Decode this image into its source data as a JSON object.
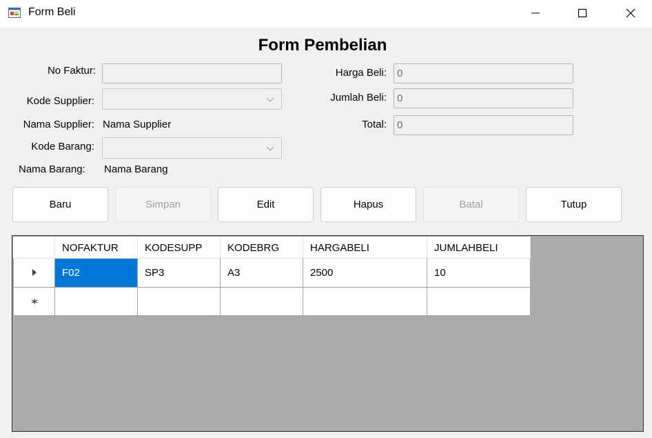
{
  "window": {
    "title": "Form Beli",
    "icon": "app-form-icon",
    "controls": [
      "minimize-icon",
      "maximize-icon",
      "close-icon"
    ]
  },
  "form": {
    "heading": "Form Pembelian",
    "left": {
      "no_faktur_label": "No Faktur:",
      "no_faktur_value": "",
      "kode_supplier_label": "Kode Supplier:",
      "kode_supplier_value": "",
      "nama_supplier_label": "Nama Supplier:",
      "nama_supplier_value": "Nama Supplier",
      "kode_barang_label": "Kode Barang:",
      "kode_barang_value": "",
      "nama_barang_label": "Nama Barang:",
      "nama_barang_value": "Nama Barang"
    },
    "right": {
      "harga_beli_label": "Harga Beli:",
      "harga_beli_value": "0",
      "jumlah_beli_label": "Jumlah Beli:",
      "jumlah_beli_value": "0",
      "total_label": "Total:",
      "total_value": "0"
    }
  },
  "buttons": {
    "baru": "Baru",
    "simpan": "Simpan",
    "edit": "Edit",
    "hapus": "Hapus",
    "batal": "Batal",
    "tutup": "Tutup"
  },
  "grid": {
    "columns": [
      "NOFAKTUR",
      "KODESUPP",
      "KODEBRG",
      "HARGABELI",
      "JUMLAHBELI"
    ],
    "rows": [
      [
        "F02",
        "SP3",
        "A3",
        "2500",
        "10"
      ]
    ],
    "current_row_marker": "row-pointer-icon",
    "new_row_marker": "new-row-icon"
  },
  "colors": {
    "selection": "#0078d7",
    "grid_background": "#ababab",
    "form_background": "#f0f0f0"
  }
}
